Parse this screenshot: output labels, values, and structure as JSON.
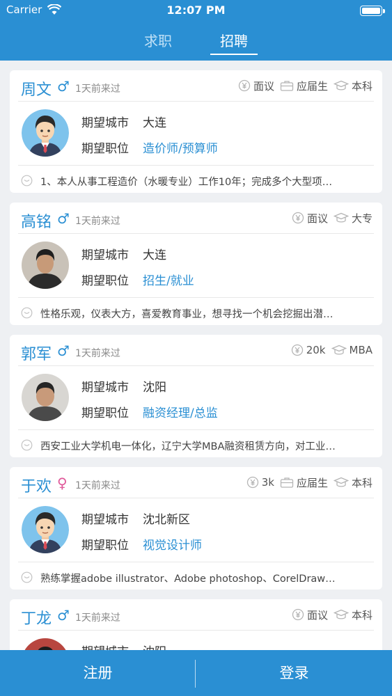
{
  "status_bar": {
    "carrier": "Carrier",
    "time": "12:07 PM"
  },
  "tabs": [
    {
      "label": "求职",
      "active": false
    },
    {
      "label": "招聘",
      "active": true
    }
  ],
  "labels": {
    "city": "期望城市",
    "position": "期望职位"
  },
  "cards": [
    {
      "name": "周文",
      "gender": "♂",
      "visited": "1天前来过",
      "tags": [
        {
          "icon": "salary-icon",
          "text": "面议"
        },
        {
          "icon": "briefcase-icon",
          "text": "应届生"
        },
        {
          "icon": "graduation-cap-icon",
          "text": "本科"
        }
      ],
      "avatar": "cartoon-avatar",
      "city": "大连",
      "position": "造价师/预算师",
      "intro": "1、本人从事工程造价（水暖专业）工作10年；完成多个大型项…"
    },
    {
      "name": "高铭",
      "gender": "♂",
      "visited": "1天前来过",
      "tags": [
        {
          "icon": "salary-icon",
          "text": "面议"
        },
        {
          "icon": "graduation-cap-icon",
          "text": "大专"
        }
      ],
      "avatar": "photo-avatar",
      "city": "大连",
      "position": "招生/就业",
      "intro": "性格乐观，仪表大方，喜爱教育事业，想寻找一个机会挖掘出潜…"
    },
    {
      "name": "郭军",
      "gender": "♂",
      "visited": "1天前来过",
      "tags": [
        {
          "icon": "salary-icon",
          "text": "20k"
        },
        {
          "icon": "graduation-cap-icon",
          "text": "MBA"
        }
      ],
      "avatar": "photo-avatar",
      "city": "沈阳",
      "position": "融资经理/总监",
      "intro": "西安工业大学机电一体化，辽宁大学MBA融资租赁方向，对工业…"
    },
    {
      "name": "于欢",
      "gender": "♀",
      "visited": "1天前来过",
      "tags": [
        {
          "icon": "salary-icon",
          "text": "3k"
        },
        {
          "icon": "briefcase-icon",
          "text": "应届生"
        },
        {
          "icon": "graduation-cap-icon",
          "text": "本科"
        }
      ],
      "avatar": "cartoon-avatar",
      "city": "沈北新区",
      "position": "视觉设计师",
      "intro": "熟练掌握adobe illustrator、Adobe photoshop、CorelDraw…"
    },
    {
      "name": "丁龙",
      "gender": "♂",
      "visited": "1天前来过",
      "tags": [
        {
          "icon": "salary-icon",
          "text": "面议"
        },
        {
          "icon": "graduation-cap-icon",
          "text": "本科"
        }
      ],
      "avatar": "photo-avatar",
      "city": "沈阳",
      "position": "",
      "intro": ""
    }
  ],
  "bottom_bar": {
    "register": "注册",
    "login": "登录"
  },
  "colors": {
    "brand": "#2a8fd3",
    "female": "#e05a9a",
    "background": "#eef0f3"
  }
}
